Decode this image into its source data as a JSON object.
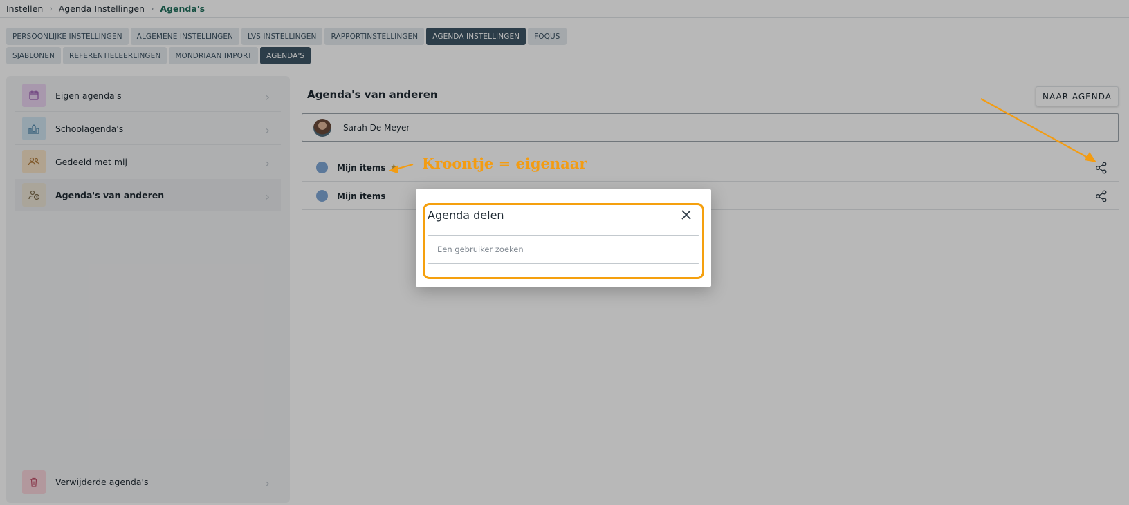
{
  "breadcrumb": {
    "items": [
      "Instellen",
      "Agenda Instellingen",
      "Agenda's"
    ]
  },
  "tabs": {
    "row1": [
      "PERSOONLIJKE INSTELLINGEN",
      "ALGEMENE INSTELLINGEN",
      "LVS INSTELLINGEN",
      "RAPPORTINSTELLINGEN",
      "AGENDA INSTELLINGEN",
      "FOQUS"
    ],
    "row2": [
      "SJABLONEN",
      "REFERENTIELEERLINGEN",
      "MONDRIAAN IMPORT",
      "AGENDA'S"
    ],
    "active_row1": "AGENDA INSTELLINGEN",
    "active_row2": "AGENDA'S"
  },
  "sidebar": {
    "items": [
      {
        "label": "Eigen agenda's",
        "icon": "calendar-icon",
        "color": "#e9d3f0"
      },
      {
        "label": "Schoolagenda's",
        "icon": "school-icon",
        "color": "#cfe3f0"
      },
      {
        "label": "Gedeeld met mij",
        "icon": "users-icon",
        "color": "#f6e2c6"
      },
      {
        "label": "Agenda's van anderen",
        "icon": "user-clock-icon",
        "color": "#ece5d6"
      }
    ],
    "bottom_item": {
      "label": "Verwijderde agenda's",
      "icon": "trash-icon",
      "color": "#f7d3da"
    }
  },
  "main": {
    "title": "Agenda's van anderen",
    "button_label": "NAAR AGENDA",
    "selected_user": "Sarah De Meyer",
    "calendars": [
      {
        "label": "Mijn items",
        "owner_star": true
      },
      {
        "label": "Mijn items",
        "owner_star": false
      }
    ]
  },
  "annotation": {
    "text": "Kroontje = eigenaar",
    "color": "#f39c12"
  },
  "dialog": {
    "title": "Agenda delen",
    "search_placeholder": "Een gebruiker zoeken",
    "highlight_color": "#f5a00e"
  },
  "colors": {
    "active_tab": "#3e5566",
    "accent_green": "#1f6f5c",
    "calendar_dot": "#7fa7d6"
  }
}
